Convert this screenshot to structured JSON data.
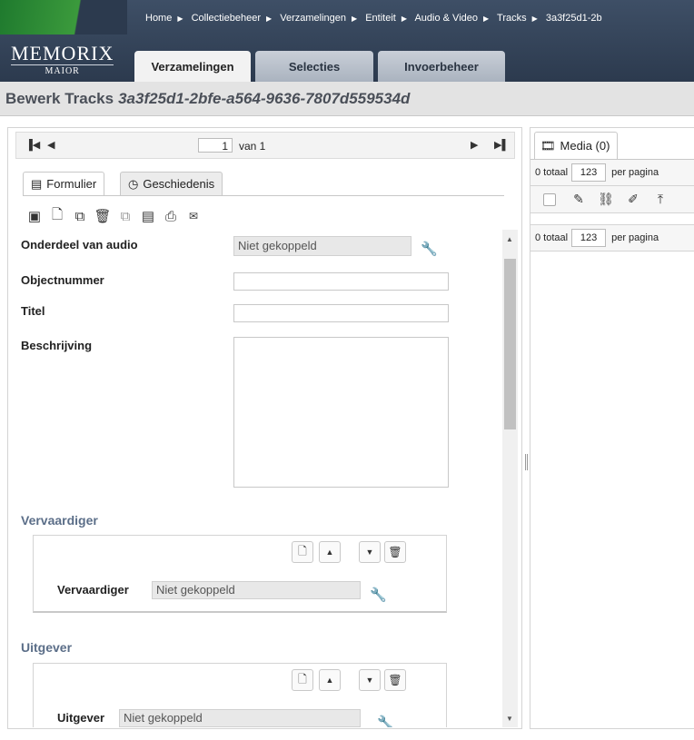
{
  "breadcrumb": [
    "Home",
    "Collectiebeheer",
    "Verzamelingen",
    "Entiteit",
    "Audio & Video",
    "Tracks",
    "3a3f25d1-2b"
  ],
  "logo": {
    "name": "MEMORIX",
    "sub": "MAIOR"
  },
  "nav_tabs": [
    "Verzamelingen",
    "Selecties",
    "Invoerbeheer"
  ],
  "title": {
    "prefix": "Bewerk Tracks",
    "id": "3a3f25d1-2bfe-a564-9636-7807d559534d"
  },
  "pager": {
    "page": "1",
    "of_label": "van 1"
  },
  "form_tabs": {
    "formulier": "Formulier",
    "geschiedenis": "Geschiedenis"
  },
  "fields": {
    "onderdeel": {
      "label": "Onderdeel van audio",
      "value": "Niet gekoppeld"
    },
    "objectnummer": {
      "label": "Objectnummer",
      "value": ""
    },
    "titel": {
      "label": "Titel",
      "value": ""
    },
    "beschrijving": {
      "label": "Beschrijving",
      "value": ""
    }
  },
  "sections": {
    "vervaardiger": {
      "title": "Vervaardiger",
      "label": "Vervaardiger",
      "value": "Niet gekoppeld"
    },
    "uitgever": {
      "title": "Uitgever",
      "label": "Uitgever",
      "value": "Niet gekoppeld"
    }
  },
  "media": {
    "tab": "Media (0)",
    "total": "0 totaal",
    "per_page_value": "123",
    "per_page_label": "per pagina"
  },
  "icons": {
    "toolbar": [
      "save-icon",
      "new-record-icon",
      "copy-icon",
      "delete-icon",
      "duplicate-icon",
      "notes-icon",
      "print-icon",
      "mail-icon"
    ],
    "media_toolbar": [
      "edit-icon",
      "unlink-icon",
      "edit-link-icon",
      "upload-icon"
    ]
  },
  "colors": {
    "header": "#2c3a4e",
    "section_title": "#5b6e88",
    "title_text": "#4a4f58"
  }
}
